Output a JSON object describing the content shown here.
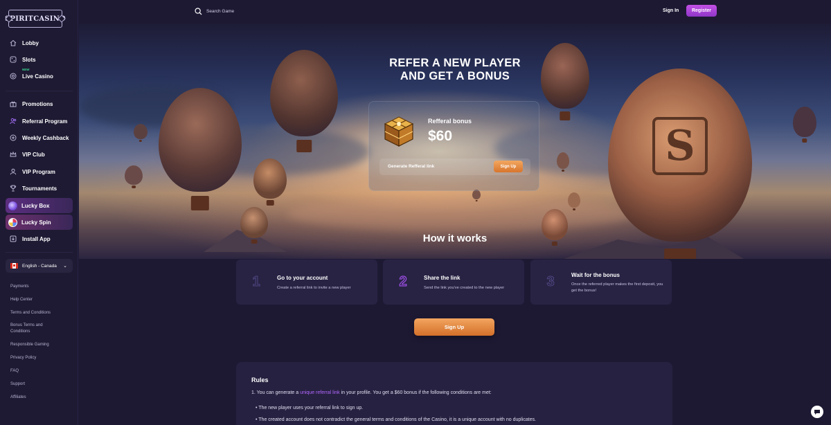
{
  "logo": {
    "text": "SPIRITCASINO"
  },
  "sidebar": {
    "items": [
      {
        "label": "Lobby",
        "icon": "home-icon"
      },
      {
        "label": "Slots",
        "icon": "dice-icon"
      },
      {
        "label": "Live Casino",
        "icon": "chip-icon",
        "badge": "NEW"
      },
      {
        "label": "Promotions",
        "icon": "gift-icon"
      },
      {
        "label": "Referral Program",
        "icon": "users-icon"
      },
      {
        "label": "Weekly Cashback",
        "icon": "cashback-icon"
      },
      {
        "label": "VIP Club",
        "icon": "crown-icon"
      },
      {
        "label": "VIP Program",
        "icon": "user-icon"
      },
      {
        "label": "Tournaments",
        "icon": "trophy-icon"
      },
      {
        "label": "Lucky Box",
        "icon": "lucky-box-icon"
      },
      {
        "label": "Lucky Spin",
        "icon": "lucky-spin-icon"
      },
      {
        "label": "Install App",
        "icon": "download-icon"
      }
    ],
    "language": "English - Canada",
    "footer_links": [
      "Payments",
      "Help Center",
      "Terms and Conditions",
      "Bonus Terms and Conditions",
      "Responsible Gaming",
      "Privacy Policy",
      "FAQ",
      "Support",
      "Affiliates"
    ]
  },
  "header": {
    "search_placeholder": "Search Game",
    "signin_label": "Sign In",
    "register_label": "Register"
  },
  "hero": {
    "title_line1": "REFER A NEW PLAYER",
    "title_line2": "AND GET A BONUS",
    "bonus_label": "Refferal bonus",
    "bonus_amount": "$60",
    "generate_label": "Generate Refferal link",
    "signup_label": "Sign Up",
    "how_title": "How it works"
  },
  "steps": [
    {
      "num": "1",
      "title": "Go to your account",
      "desc": "Create a referral link to invite a new player"
    },
    {
      "num": "2",
      "title": "Share the link",
      "desc": "Send the link you've created to the new player"
    },
    {
      "num": "3",
      "title": "Wait for the bonus",
      "desc": "Once the referred player makes the first deposit, you get the bonus!"
    }
  ],
  "signup_button": "Sign Up",
  "rules": {
    "heading": "Rules",
    "p1_before": "1. You can generate a ",
    "p1_link": "unique referral link",
    "p1_after": " in your profile. You get a $60 bonus if the following conditions are met:",
    "bullet1": "• The new player uses your referral link to sign up.",
    "bullet2": "• The created account does not contradict the general terms and conditions of the Casino, it is a unique account with no duplicates."
  },
  "colors": {
    "accent_purple": "#9e4fe8",
    "accent_orange": "#e08a3e",
    "bg": "#1d1933"
  }
}
